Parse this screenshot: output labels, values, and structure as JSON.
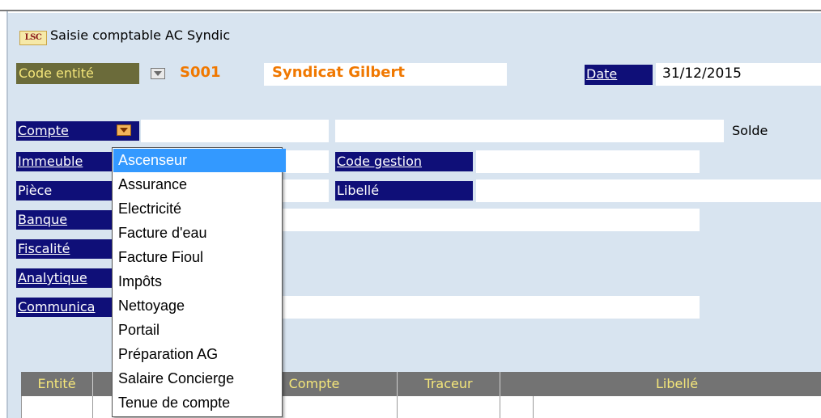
{
  "window": {
    "title": "Saisie comptable AC Syndic",
    "logo_text": "LSC"
  },
  "header": {
    "code_entite_label": "Code entité",
    "entity_code": "S001",
    "entity_name": "Syndicat Gilbert",
    "date_label": "Date",
    "date_value": "31/12/2015"
  },
  "form": {
    "compte_label": "Compte",
    "solde_label": "Solde",
    "immeuble_label": "Immeuble",
    "code_gestion_label": "Code gestion",
    "piece_label": "Pièce",
    "libelle_label": "Libellé",
    "banque_label": "Banque",
    "fiscalite_label": "Fiscalité",
    "analytique_label": "Analytique",
    "communication_label": "Communica"
  },
  "dropdown": {
    "selected_index": 0,
    "items": [
      "Ascenseur",
      "Assurance",
      "Electricité",
      "Facture d'eau",
      "Facture Fioul",
      "Impôts",
      "Nettoyage",
      "Portail",
      "Préparation AG",
      "Salaire Concierge",
      "Tenue de compte"
    ]
  },
  "grid": {
    "columns": [
      "Entité",
      "",
      "Compte",
      "Traceur",
      "",
      "Libellé"
    ]
  },
  "colors": {
    "panel": "#d8e4f0",
    "navy_label": "#0f0f78",
    "olive_label": "#6b6b3a",
    "orange_text": "#f07800",
    "selection": "#3399ff",
    "grid_header": "#737373"
  }
}
